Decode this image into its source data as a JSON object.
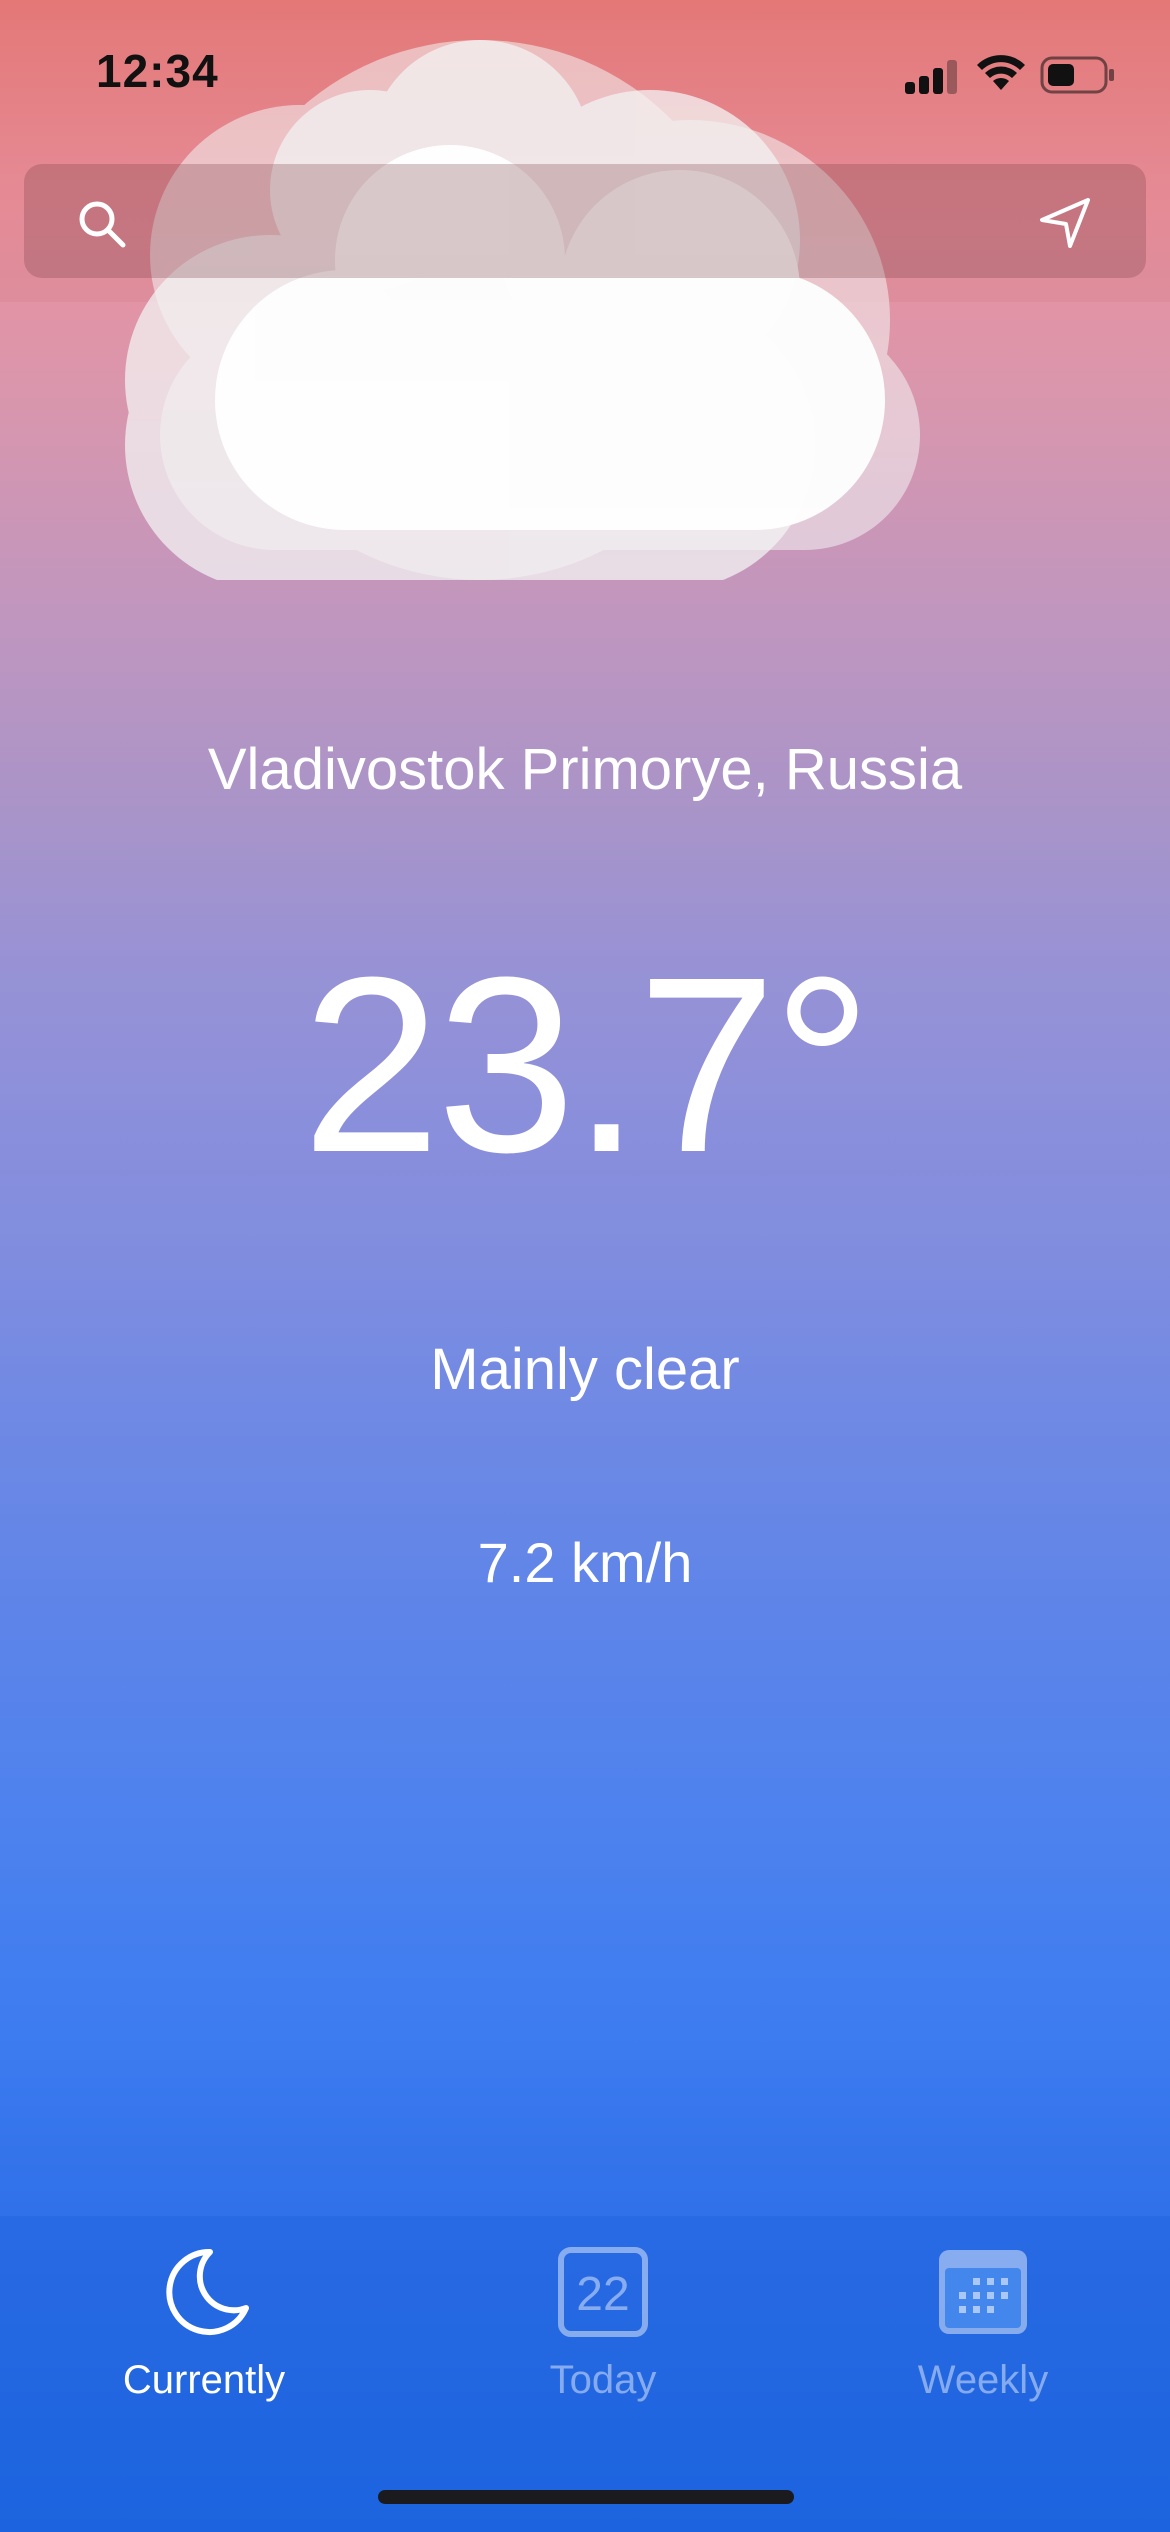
{
  "status_bar": {
    "time": "12:34"
  },
  "search": {
    "value": "",
    "placeholder": ""
  },
  "weather": {
    "city": "Vladivostok Primorye, Russia",
    "temperature": "23.7°",
    "condition": "Mainly clear",
    "wind": "7.2 km/h",
    "icon": "cloud-icon"
  },
  "tabs": [
    {
      "label": "Currently",
      "icon": "moon-icon",
      "active": true
    },
    {
      "label": "Today",
      "icon": "calendar-day-icon",
      "day_number": "22",
      "active": false
    },
    {
      "label": "Weekly",
      "icon": "calendar-week-icon",
      "active": false
    }
  ],
  "colors": {
    "gradient_top": "#eb7a78",
    "gradient_middle": "#9892d5",
    "gradient_bottom": "#1f66e3",
    "text": "#ffffff"
  }
}
